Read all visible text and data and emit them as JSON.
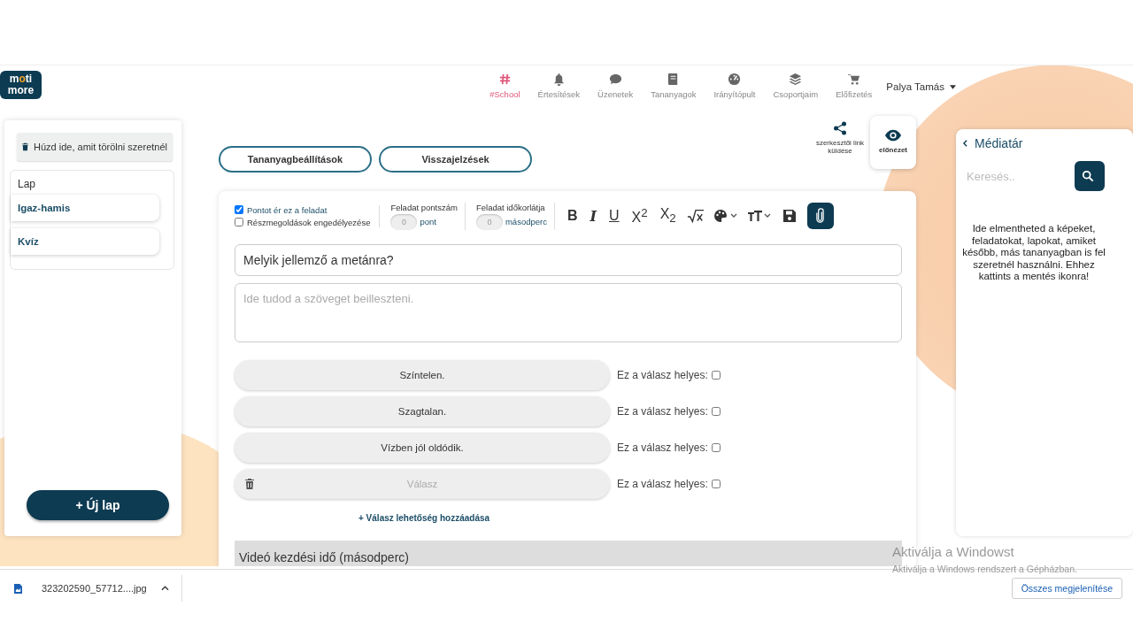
{
  "logo": {
    "line1": "moti",
    "line2": "more"
  },
  "nav": [
    {
      "label": "#School",
      "selected": true
    },
    {
      "label": "Értesítések",
      "selected": false
    },
    {
      "label": "Üzenetek",
      "selected": false
    },
    {
      "label": "Tananyagok",
      "selected": false
    },
    {
      "label": "Irányítópult",
      "selected": false
    },
    {
      "label": "Csoportjaim",
      "selected": false
    },
    {
      "label": "Előfizetés",
      "selected": false
    }
  ],
  "user": {
    "name": "Palya Tamás"
  },
  "left_panel": {
    "trash_zone": "Húzd ide, amit törölni szeretnél",
    "list_title": "Lap",
    "pages": [
      {
        "label": "Igaz-hamis"
      },
      {
        "label": "Kvíz"
      }
    ],
    "new_page_button": "+ Új lap"
  },
  "top_buttons": [
    "Tananyagbeállítások",
    "Visszajelzések"
  ],
  "actions": [
    {
      "kind": "share",
      "label": "szerkesztői link küldése"
    },
    {
      "kind": "preview",
      "label": "előnézet"
    }
  ],
  "editor": {
    "options": [
      {
        "label": "Pontot ér ez a feladat",
        "checked": true
      },
      {
        "label": "Részmegoldások engedélyezése",
        "checked": false
      }
    ],
    "settings": [
      {
        "label": "Feladat pontszám",
        "placeholder": "0",
        "unit": "pont"
      },
      {
        "label": "Feladat időkorlátja",
        "placeholder": "0",
        "unit": "másodperc"
      }
    ],
    "toolbar": [
      {
        "kind": "bold",
        "glyph": "B"
      },
      {
        "kind": "italic",
        "glyph": "I"
      },
      {
        "kind": "underline",
        "glyph": "U"
      },
      {
        "kind": "script",
        "glyph": "X$^{2}$"
      },
      {
        "kind": "script",
        "glyph": "X$_{2}$"
      },
      {
        "kind": "sqrt"
      },
      {
        "kind": "palette"
      },
      {
        "kind": "textsize"
      },
      {
        "kind": "save"
      },
      {
        "kind": "attach"
      }
    ],
    "question": "Melyik jellemző a metánra?",
    "description_placeholder": "Ide tudod a szöveget beilleszteni.",
    "answers": [
      {
        "kind": "answer",
        "value": "Színtelen.",
        "correct_label": "Ez a válasz helyes:",
        "checked": false
      },
      {
        "kind": "answer",
        "value": "Szagtalan.",
        "correct_label": "Ez a válasz helyes:",
        "checked": false
      },
      {
        "kind": "answer",
        "value": "Vízben jól oldódik.",
        "correct_label": "Ez a válasz helyes:",
        "checked": false
      },
      {
        "kind": "empty",
        "placeholder": "Válasz",
        "correct_label": "Ez a válasz helyes:",
        "checked": false
      }
    ],
    "add_answer": "+ Válasz lehetőség hozzáadása",
    "video_section": "Videó kezdési idő (másodperc)"
  },
  "media_panel": {
    "title": "Médiatár",
    "search_placeholder": "Keresés..",
    "hint": "Ide elmentheted a képeket, feladatokat, lapokat, amiket később, más tananyagban is fel szeretnél használni. Ehhez kattints a mentés ikonra!"
  },
  "download_bar": {
    "file": "323202590_57712....jpg",
    "show_all": "Összes megjelenítése"
  },
  "windows_notice": {
    "title": "Aktiválja a Windowst",
    "subtitle": "Aktiválja a Windows rendszert a Gépházban."
  }
}
